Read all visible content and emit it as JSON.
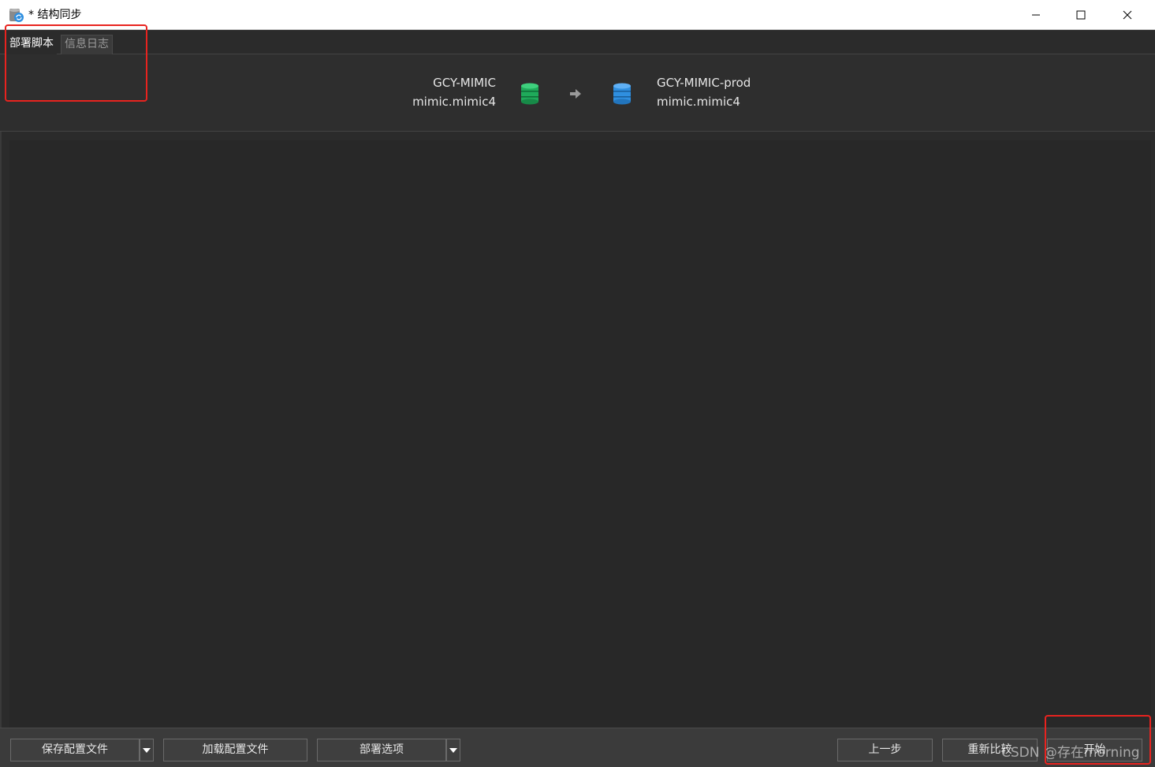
{
  "window": {
    "title": "* 结构同步",
    "icon": "database-sync-icon"
  },
  "window_controls": {
    "minimize_icon": "minimize-icon",
    "maximize_icon": "maximize-icon",
    "close_icon": "close-icon"
  },
  "tabs": [
    {
      "label": "部署脚本",
      "active": true
    },
    {
      "label": "信息日志",
      "active": false
    }
  ],
  "connection": {
    "source": {
      "connection_name": "GCY-MIMIC",
      "schema": "mimic.mimic4",
      "icon": "database-green-icon",
      "color": "#1faa5a"
    },
    "target": {
      "connection_name": "GCY-MIMIC-prod",
      "schema": "mimic.mimic4",
      "icon": "database-blue-icon",
      "color": "#2f8fe0"
    },
    "arrow_icon": "arrow-right-icon"
  },
  "footer": {
    "save_profile_label": "保存配置文件",
    "load_profile_label": "加载配置文件",
    "deploy_options_label": "部署选项",
    "previous_label": "上一步",
    "recompare_label": "重新比较",
    "start_label": "开始"
  },
  "watermark": "CSDN @存在morning",
  "annotation_color": "#e8231f"
}
